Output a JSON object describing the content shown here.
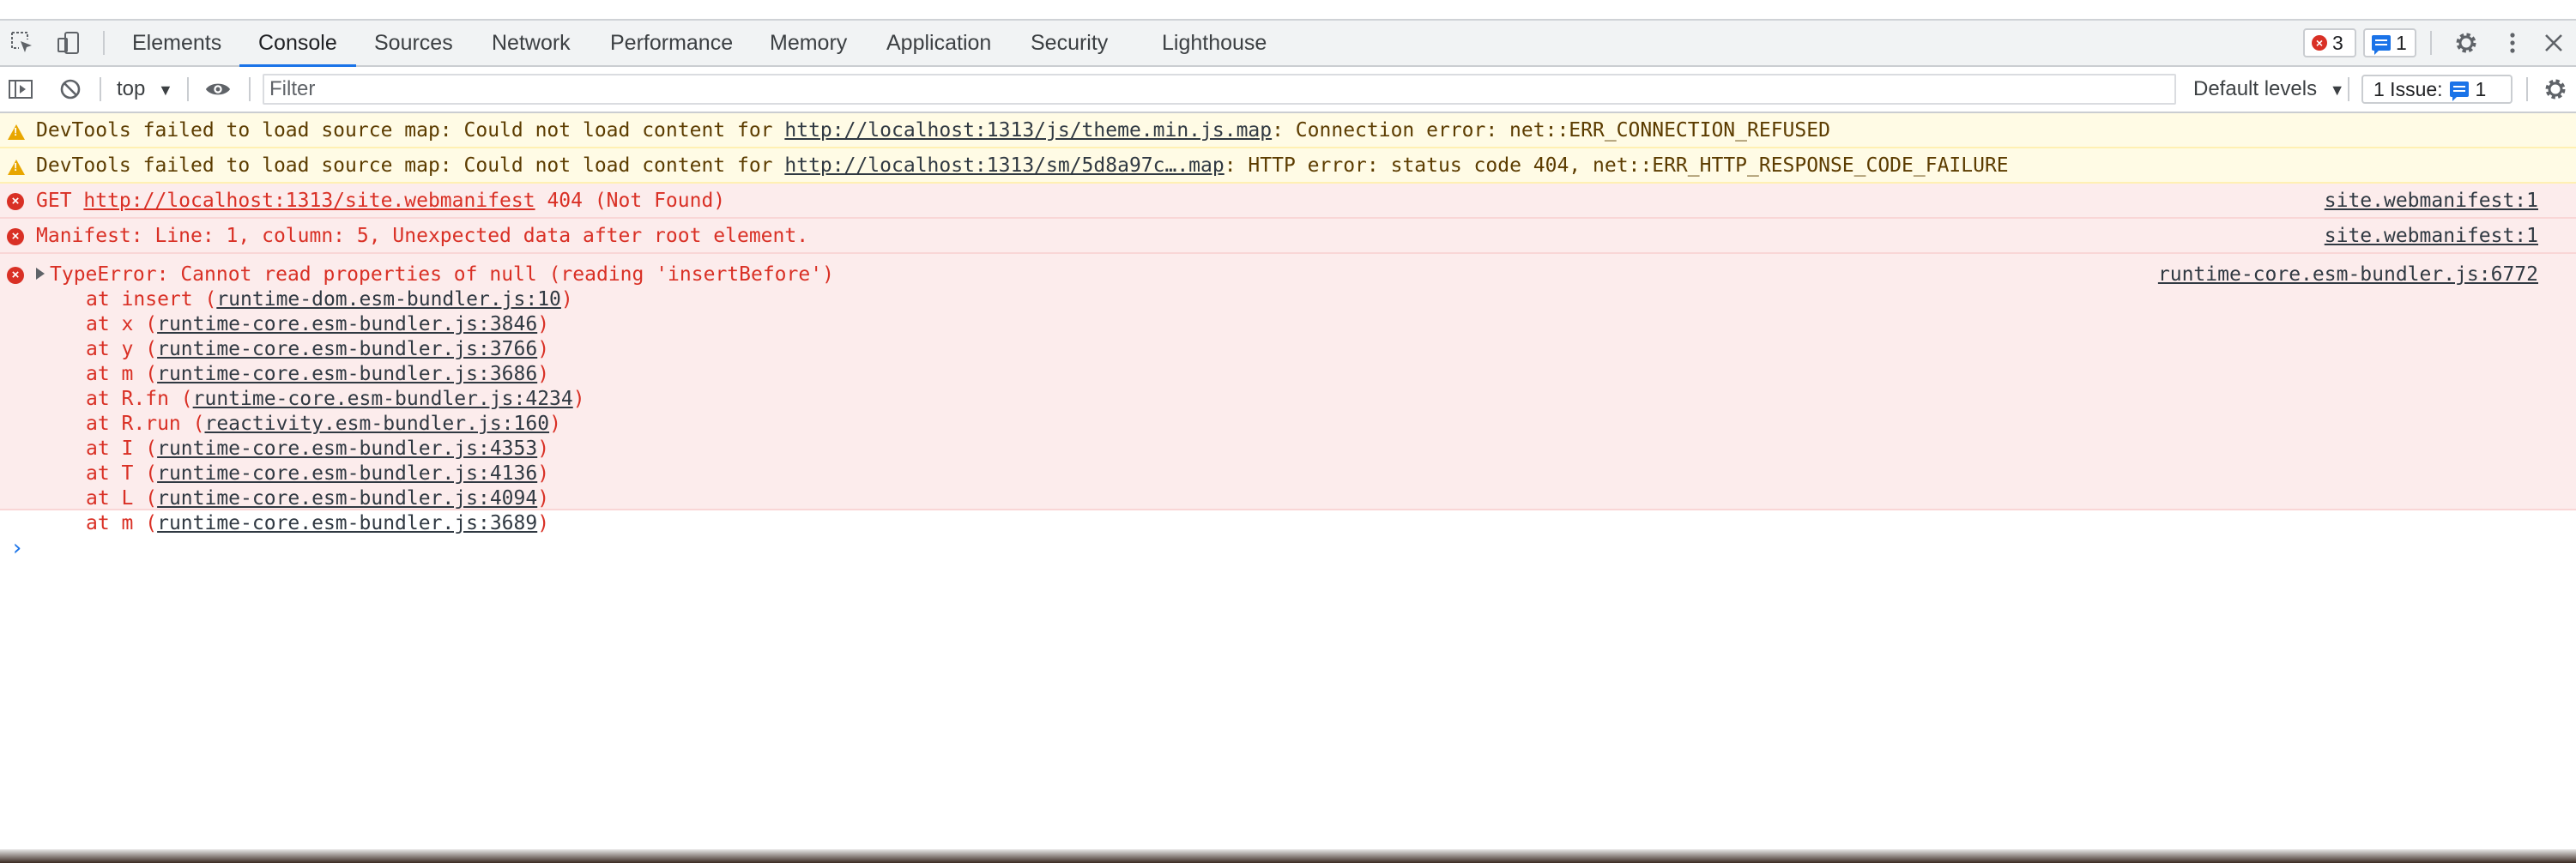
{
  "tabs": [
    "Elements",
    "Console",
    "Sources",
    "Network",
    "Performance",
    "Memory",
    "Application",
    "Security",
    "Lighthouse"
  ],
  "active_tab": "Console",
  "status": {
    "errors": "3",
    "messages": "1"
  },
  "toolbar": {
    "context": "top",
    "filter_placeholder": "Filter",
    "levels": "Default levels",
    "issues_label": "1 Issue:",
    "issues_count": "1"
  },
  "messages": [
    {
      "level": "warning",
      "prefix": "DevTools failed to load source map: Could not load content for ",
      "link": "http://localhost:1313/js/theme.min.js.map",
      "suffix": ": Connection error: net::ERR_CONNECTION_REFUSED"
    },
    {
      "level": "warning",
      "prefix": "DevTools failed to load source map: Could not load content for ",
      "link": "http://localhost:1313/sm/5d8a97c….map",
      "suffix": ": HTTP error: status code 404, net::ERR_HTTP_RESPONSE_CODE_FAILURE"
    },
    {
      "level": "error",
      "prefix": "GET ",
      "link": "http://localhost:1313/site.webmanifest",
      "suffix": " 404 (Not Found)",
      "source": "site.webmanifest:1"
    },
    {
      "level": "error",
      "text": "Manifest: Line: 1, column: 5, Unexpected data after root element.",
      "source": "site.webmanifest:1"
    },
    {
      "level": "error",
      "text": "TypeError: Cannot read properties of null (reading 'insertBefore')",
      "source": "runtime-core.esm-bundler.js:6772",
      "stack": [
        {
          "fn": "at insert (",
          "loc": "runtime-dom.esm-bundler.js:10"
        },
        {
          "fn": "at x (",
          "loc": "runtime-core.esm-bundler.js:3846"
        },
        {
          "fn": "at y (",
          "loc": "runtime-core.esm-bundler.js:3766"
        },
        {
          "fn": "at m (",
          "loc": "runtime-core.esm-bundler.js:3686"
        },
        {
          "fn": "at R.fn (",
          "loc": "runtime-core.esm-bundler.js:4234"
        },
        {
          "fn": "at R.run (",
          "loc": "reactivity.esm-bundler.js:160"
        },
        {
          "fn": "at I (",
          "loc": "runtime-core.esm-bundler.js:4353"
        },
        {
          "fn": "at T (",
          "loc": "runtime-core.esm-bundler.js:4136"
        },
        {
          "fn": "at L (",
          "loc": "runtime-core.esm-bundler.js:4094"
        },
        {
          "fn": "at m (",
          "loc": "runtime-core.esm-bundler.js:3689"
        }
      ]
    }
  ],
  "prompt": "›"
}
